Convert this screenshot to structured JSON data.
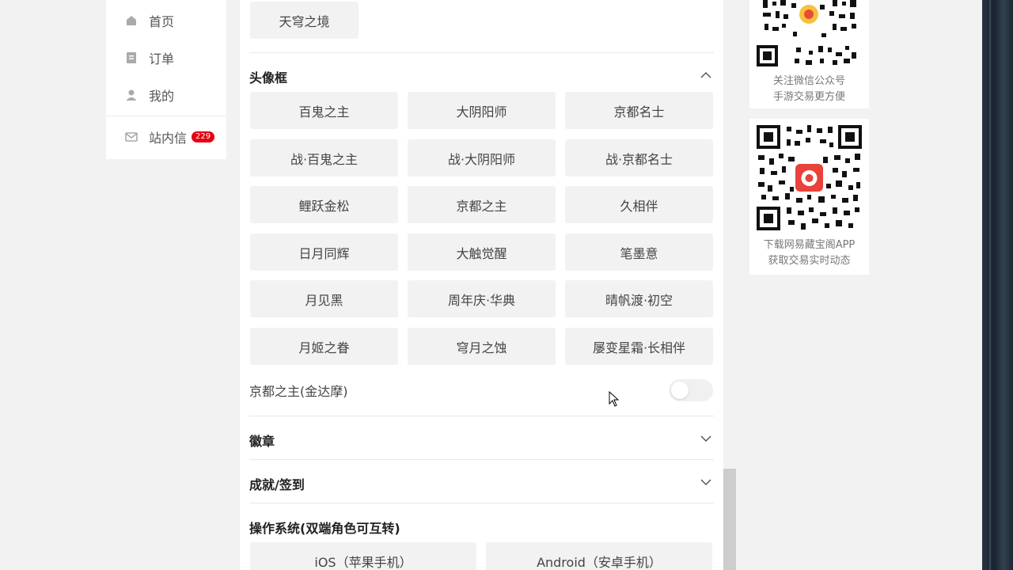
{
  "nav": {
    "items": [
      {
        "label": "首页",
        "icon": "home-icon"
      },
      {
        "label": "订单",
        "icon": "order-icon"
      },
      {
        "label": "我的",
        "icon": "user-icon"
      },
      {
        "label": "站内信",
        "icon": "mail-icon",
        "badge": "229"
      }
    ]
  },
  "top_option": "天穹之境",
  "avatar_frame": {
    "title": "头像框",
    "options": [
      "百鬼之主",
      "大阴阳师",
      "京都名士",
      "战·百鬼之主",
      "战·大阴阳师",
      "战·京都名士",
      "鲤跃金松",
      "京都之主",
      "久相伴",
      "日月同辉",
      "大触觉醒",
      "笔墨意",
      "月见黑",
      "周年庆·华典",
      "晴帆渡·初空",
      "月姬之眷",
      "穹月之蚀",
      "屡变星霜·长相伴"
    ],
    "toggle_label": "京都之主(金达摩)",
    "toggle_on": false
  },
  "badge_section": {
    "title": "徽章"
  },
  "achievement_section": {
    "title": "成就/签到"
  },
  "os_section": {
    "title": "操作系统(双端角色可互转)",
    "options": [
      "iOS（苹果手机）",
      "Android（安卓手机）"
    ]
  },
  "qr_wechat": {
    "line1": "关注微信公众号",
    "line2": "手游交易更方便"
  },
  "qr_app": {
    "line1": "下载网易藏宝阁APP",
    "line2": "获取交易实时动态"
  },
  "colors": {
    "accent": "#e60012",
    "option_bg": "#f2f2f2"
  }
}
